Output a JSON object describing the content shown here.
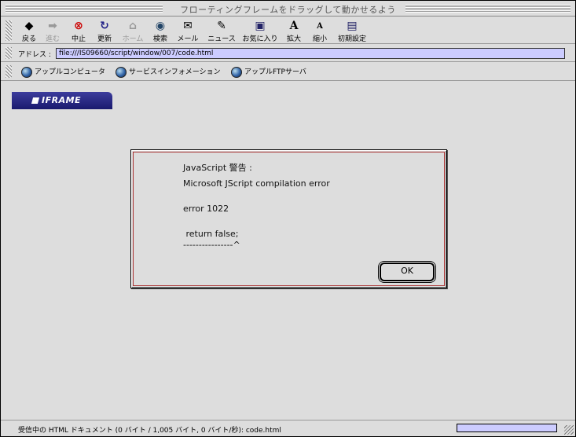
{
  "window": {
    "title": "フローティングフレームをドラッグして動かせるよう"
  },
  "toolbar": {
    "buttons": [
      {
        "label": "戻る",
        "icon": "◆",
        "disabled": false
      },
      {
        "label": "進む",
        "icon": "➡",
        "disabled": true
      },
      {
        "label": "中止",
        "icon": "⊗",
        "disabled": false
      },
      {
        "label": "更新",
        "icon": "↻",
        "disabled": false
      },
      {
        "label": "ホーム",
        "icon": "⌂",
        "disabled": true
      },
      {
        "label": "検索",
        "icon": "◉",
        "disabled": false
      },
      {
        "label": "メール",
        "icon": "✉",
        "disabled": false
      },
      {
        "label": "ニュース",
        "icon": "✎",
        "disabled": false
      },
      {
        "label": "お気に入り",
        "icon": "▣",
        "disabled": false
      },
      {
        "label": "拡大",
        "icon": "A",
        "disabled": false
      },
      {
        "label": "縮小",
        "icon": "A",
        "disabled": false
      },
      {
        "label": "初期設定",
        "icon": "▤",
        "disabled": false
      }
    ]
  },
  "address": {
    "label": "アドレス :",
    "value": "file:///IS09660/script/window/007/code.html"
  },
  "favorites": [
    {
      "label": "アップルコンピュータ"
    },
    {
      "label": "サービスインフォメーション"
    },
    {
      "label": "アップルFTPサーバ"
    }
  ],
  "content": {
    "iframe_tab_label": "IFRAME"
  },
  "dialog": {
    "title_line": "JavaScript 警告 :",
    "message_line": "Microsoft JScript compilation error",
    "error_line": "error 1022",
    "code_line": " return false;",
    "pointer_line": "----------------^",
    "ok_label": "OK"
  },
  "status": {
    "text": "受信中の HTML ドキュメント (0 バイト / 1,005 バイト, 0 バイト/秒): code.html"
  },
  "colors": {
    "address_bg": "#ccccff",
    "tab_bg": "#2a2a86",
    "dialog_border": "#aa3333"
  }
}
